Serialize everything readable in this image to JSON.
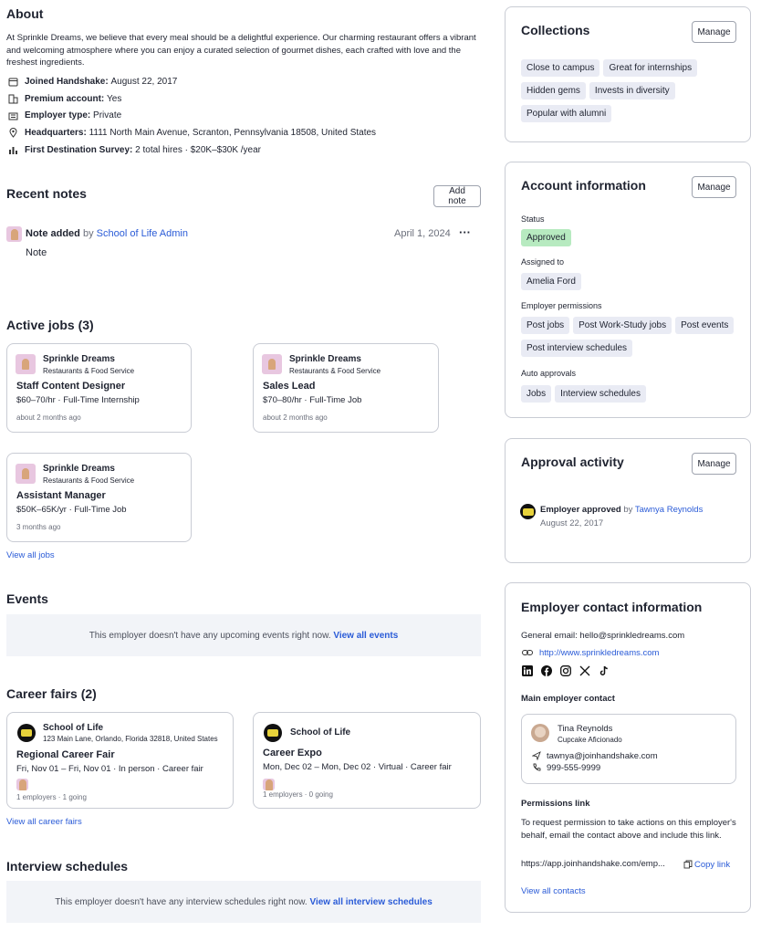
{
  "about": {
    "title": "About",
    "description": "At Sprinkle Dreams, we believe that every meal should be a delightful experience. Our charming restaurant offers a vibrant and welcoming atmosphere where you can enjoy a curated selection of gourmet dishes, each crafted with love and the freshest ingredients.",
    "facts": [
      {
        "icon": "calendar-icon",
        "label": "Joined Handshake:",
        "value": "August 22, 2017"
      },
      {
        "icon": "building-icon",
        "label": "Premium account:",
        "value": "Yes"
      },
      {
        "icon": "office-icon",
        "label": "Employer type:",
        "value": "Private"
      },
      {
        "icon": "location-pin-icon",
        "label": "Headquarters:",
        "value": "1111 North Main Avenue, Scranton, Pennsylvania 18508, United States"
      },
      {
        "icon": "chart-icon",
        "label": "First Destination Survey:",
        "value": "2 total hires · $20K–$30K /year"
      }
    ]
  },
  "notes": {
    "title": "Recent notes",
    "add_label": "Add note",
    "item": {
      "prefix": "Note added",
      "by": "by",
      "author": "School of Life Admin",
      "date": "April 1, 2024",
      "more": "···",
      "body": "Note"
    }
  },
  "jobs": {
    "title": "Active jobs (3)",
    "items": [
      {
        "company": "Sprinkle Dreams",
        "industry": "Restaurants & Food Service",
        "title": "Staff Content Designer",
        "details": "$60–70/hr · Full-Time Internship",
        "posted": "about 2 months ago"
      },
      {
        "company": "Sprinkle Dreams",
        "industry": "Restaurants & Food Service",
        "title": "Sales Lead",
        "details": "$70–80/hr · Full-Time Job",
        "posted": "about 2 months ago"
      },
      {
        "company": "Sprinkle Dreams",
        "industry": "Restaurants & Food Service",
        "title": "Assistant Manager",
        "details": "$50K–65K/yr · Full-Time Job",
        "posted": "3 months ago"
      }
    ],
    "view_all": "View all jobs"
  },
  "events": {
    "title": "Events",
    "empty": "This employer doesn't have any upcoming events right now.",
    "link": "View all events"
  },
  "fairs": {
    "title": "Career fairs (2)",
    "items": [
      {
        "org": "School of Life",
        "address": "123 Main Lane, Orlando, Florida 32818, United States",
        "title": "Regional Career Fair",
        "details": "Fri, Nov 01 – Fri, Nov 01 · In person · Career fair",
        "stats": "1 employers · 1 going"
      },
      {
        "org": "School of Life",
        "address": "",
        "title": "Career Expo",
        "details": "Mon, Dec 02 – Mon, Dec 02 · Virtual · Career fair",
        "stats": "1 employers · 0 going"
      }
    ],
    "view_all": "View all career fairs"
  },
  "schedules": {
    "title": "Interview schedules",
    "empty": "This employer doesn't have any interview schedules right now.",
    "link": "View all interview schedules"
  },
  "collections": {
    "title": "Collections",
    "manage": "Manage",
    "tags": [
      "Close to campus",
      "Great for internships",
      "Hidden gems",
      "Invests in diversity",
      "Popular with alumni"
    ]
  },
  "account": {
    "title": "Account information",
    "manage": "Manage",
    "status_label": "Status",
    "status": "Approved",
    "assigned_label": "Assigned to",
    "assigned": "Amelia Ford",
    "permissions_label": "Employer permissions",
    "permissions": [
      "Post jobs",
      "Post Work-Study jobs",
      "Post events",
      "Post interview schedules"
    ],
    "auto_label": "Auto approvals",
    "auto": [
      "Jobs",
      "Interview schedules"
    ]
  },
  "approval": {
    "title": "Approval activity",
    "manage": "Manage",
    "action": "Employer approved",
    "by": "by",
    "person": "Tawnya Reynolds",
    "date": "August 22, 2017"
  },
  "contact": {
    "title": "Employer contact information",
    "email_label": "General email:",
    "email": "hello@sprinkledreams.com",
    "website": "http://www.sprinkledreams.com",
    "socials": [
      "linkedin-icon",
      "facebook-icon",
      "instagram-icon",
      "x-icon",
      "tiktok-icon"
    ],
    "main_label": "Main employer contact",
    "person_name": "Tina Reynolds",
    "person_role": "Cupcake Aficionado",
    "person_email": "tawnya@joinhandshake.com",
    "person_phone": "999-555-9999",
    "perm_label": "Permissions link",
    "perm_text": "To request permission to take actions on this employer's behalf, email the contact above and include this link.",
    "perm_url": "https://app.joinhandshake.com/emp...",
    "copy": "Copy link",
    "view_all": "View all contacts"
  }
}
